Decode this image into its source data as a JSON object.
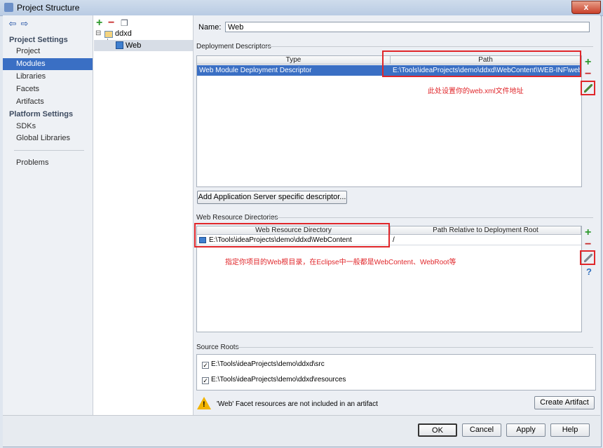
{
  "window": {
    "title": "Project Structure",
    "close_glyph": "x"
  },
  "nav": {
    "back": "⇦",
    "forward": "⇨"
  },
  "sidebar": {
    "project_settings_title": "Project Settings",
    "platform_settings_title": "Platform Settings",
    "items": [
      "Project",
      "Modules",
      "Libraries",
      "Facets",
      "Artifacts"
    ],
    "platform_items": [
      "SDKs",
      "Global Libraries"
    ],
    "problems": "Problems",
    "selected": "Modules"
  },
  "tree": {
    "toolbar": {
      "add": "+",
      "remove": "−",
      "copy": "❐"
    },
    "root": {
      "toggle": "⊟",
      "label": "ddxd"
    },
    "child": {
      "label": "Web"
    }
  },
  "name_field": {
    "label": "Name:",
    "value": "Web"
  },
  "deployment": {
    "title": "Deployment Descriptors",
    "columns": [
      "Type",
      "Path"
    ],
    "rows": [
      {
        "type": "Web Module Deployment Descriptor",
        "path": "E:\\Tools\\ideaProjects\\demo\\ddxd\\WebContent\\WEB-INF\\web.xml"
      }
    ],
    "annotation": "此处设置你的web.xml文件地址",
    "add_descriptor_button": "Add Application Server specific descriptor...",
    "add": "+",
    "remove": "−"
  },
  "web_resources": {
    "title": "Web Resource Directories",
    "columns": [
      "Web Resource Directory",
      "Path Relative to Deployment Root"
    ],
    "rows": [
      {
        "directory": "E:\\Tools\\ideaProjects\\demo\\ddxd\\WebContent",
        "relative": "/"
      }
    ],
    "annotation": "指定你项目的Web根目录，在Eclipse中一般都是WebContent、WebRoot等",
    "add": "+",
    "remove": "−",
    "help": "?"
  },
  "source_roots": {
    "title": "Source Roots",
    "items": [
      {
        "checked": "✓",
        "path": "E:\\Tools\\ideaProjects\\demo\\ddxd\\src"
      },
      {
        "checked": "✓",
        "path": "E:\\Tools\\ideaProjects\\demo\\ddxd\\resources"
      }
    ]
  },
  "warning": {
    "icon_mark": "!",
    "text": "'Web' Facet resources are not included in an artifact"
  },
  "create_artifact_button": "Create Artifact",
  "dialog_buttons": {
    "ok": "OK",
    "cancel": "Cancel",
    "apply": "Apply",
    "help": "Help"
  },
  "colors": {
    "accent": "#3a6fc4",
    "annotation_red": "#e0262a",
    "add_green": "#2e9a2e",
    "remove_red": "#c62828"
  }
}
